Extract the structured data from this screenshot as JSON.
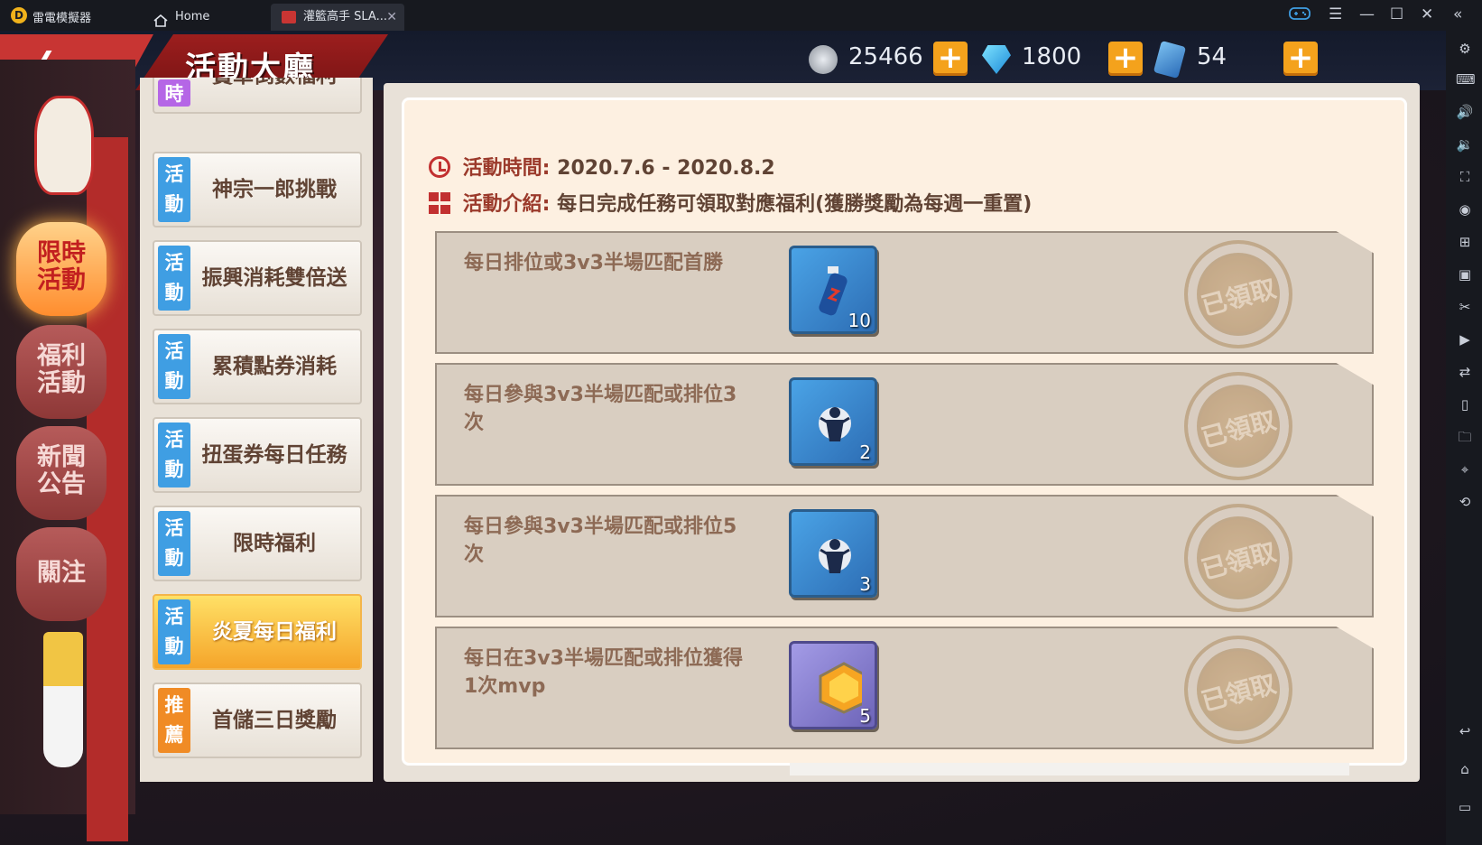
{
  "emulator": {
    "app_name": "雷電模擬器",
    "tabs": [
      {
        "label": "Home"
      },
      {
        "label": "灌籃高手 SLA..."
      }
    ]
  },
  "header": {
    "title": "活動大廳",
    "currencies": [
      {
        "name": "coin-icon",
        "value": "25466"
      },
      {
        "name": "diamond-icon",
        "value": "1800"
      },
      {
        "name": "ticket-icon",
        "value": "54"
      }
    ]
  },
  "lanterns": [
    {
      "label": "限時\n活動",
      "active": true
    },
    {
      "label": "福利\n活動",
      "active": false
    },
    {
      "label": "新聞\n公告",
      "active": false
    },
    {
      "label": "關注",
      "active": false
    }
  ],
  "events": [
    {
      "tag": "時",
      "label": "賣單倒數福利",
      "tag_color": "purple",
      "active": false
    },
    {
      "tag": "活\n動",
      "label": "神宗一郎挑戰",
      "tag_color": "blue",
      "active": false
    },
    {
      "tag": "活\n動",
      "label": "振興消耗雙倍送",
      "tag_color": "blue",
      "active": false
    },
    {
      "tag": "活\n動",
      "label": "累積點券消耗",
      "tag_color": "blue",
      "active": false
    },
    {
      "tag": "活\n動",
      "label": "扭蛋券每日任務",
      "tag_color": "blue",
      "active": false
    },
    {
      "tag": "活\n動",
      "label": "限時福利",
      "tag_color": "blue",
      "active": false
    },
    {
      "tag": "活\n動",
      "label": "炎夏每日福利",
      "tag_color": "blue",
      "active": true
    },
    {
      "tag": "推\n薦",
      "label": "首儲三日獎勵",
      "tag_color": "orange",
      "active": false
    }
  ],
  "detail": {
    "time_label": "活動時間:",
    "time_value": "2020.7.6 - 2020.8.2",
    "intro_label": "活動介紹:",
    "intro_value": "每日完成任務可領取對應福利(獲勝獎勵為每週一重置)"
  },
  "tasks": [
    {
      "text": "每日排位或3v3半場匹配首勝",
      "reward_icon": "drink-bottle-icon",
      "reward_count": "10",
      "status": "已領取"
    },
    {
      "text": "每日參與3v3半場匹配或排位3次",
      "reward_icon": "player-card-icon",
      "reward_count": "2",
      "status": "已領取"
    },
    {
      "text": "每日參與3v3半場匹配或排位5次",
      "reward_icon": "player-card-icon",
      "reward_count": "3",
      "status": "已領取"
    },
    {
      "text": "每日在3v3半場匹配或排位獲得1次mvp",
      "reward_icon": "hexagon-gem-icon",
      "reward_count": "5",
      "status": "已領取"
    }
  ],
  "colors": {
    "accent_red": "#c83533",
    "active_orange": "#f5a52a",
    "tag_blue": "#3f9ee3",
    "text_brown": "#604334"
  }
}
